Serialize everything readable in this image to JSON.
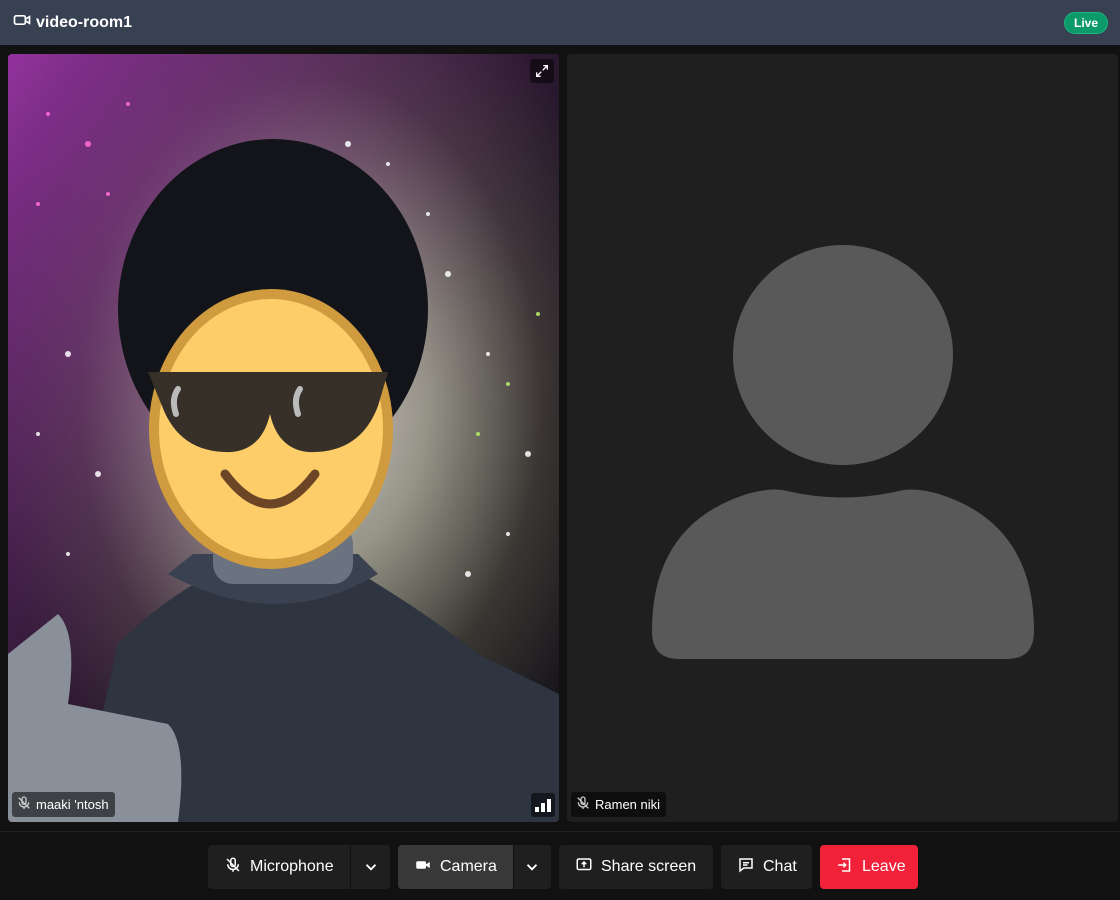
{
  "header": {
    "room_name": "video-room1",
    "live_label": "Live",
    "live_color": "#0d9a6a"
  },
  "participants": [
    {
      "name": "maaki 'ntosh",
      "mic": "muted",
      "connection_quality": "excellent",
      "video": "on"
    },
    {
      "name": "Ramen niki",
      "mic": "muted",
      "video": "off"
    }
  ],
  "controls": {
    "microphone_label": "Microphone",
    "camera_label": "Camera",
    "share_label": "Share screen",
    "chat_label": "Chat",
    "leave_label": "Leave",
    "leave_color": "#f2213a"
  },
  "icons": [
    "video-camera-icon",
    "mic-off-icon",
    "signal-bars-icon",
    "expand-icon",
    "chevron-down-icon",
    "share-screen-icon",
    "chat-icon",
    "leave-icon",
    "avatar-placeholder-icon"
  ]
}
